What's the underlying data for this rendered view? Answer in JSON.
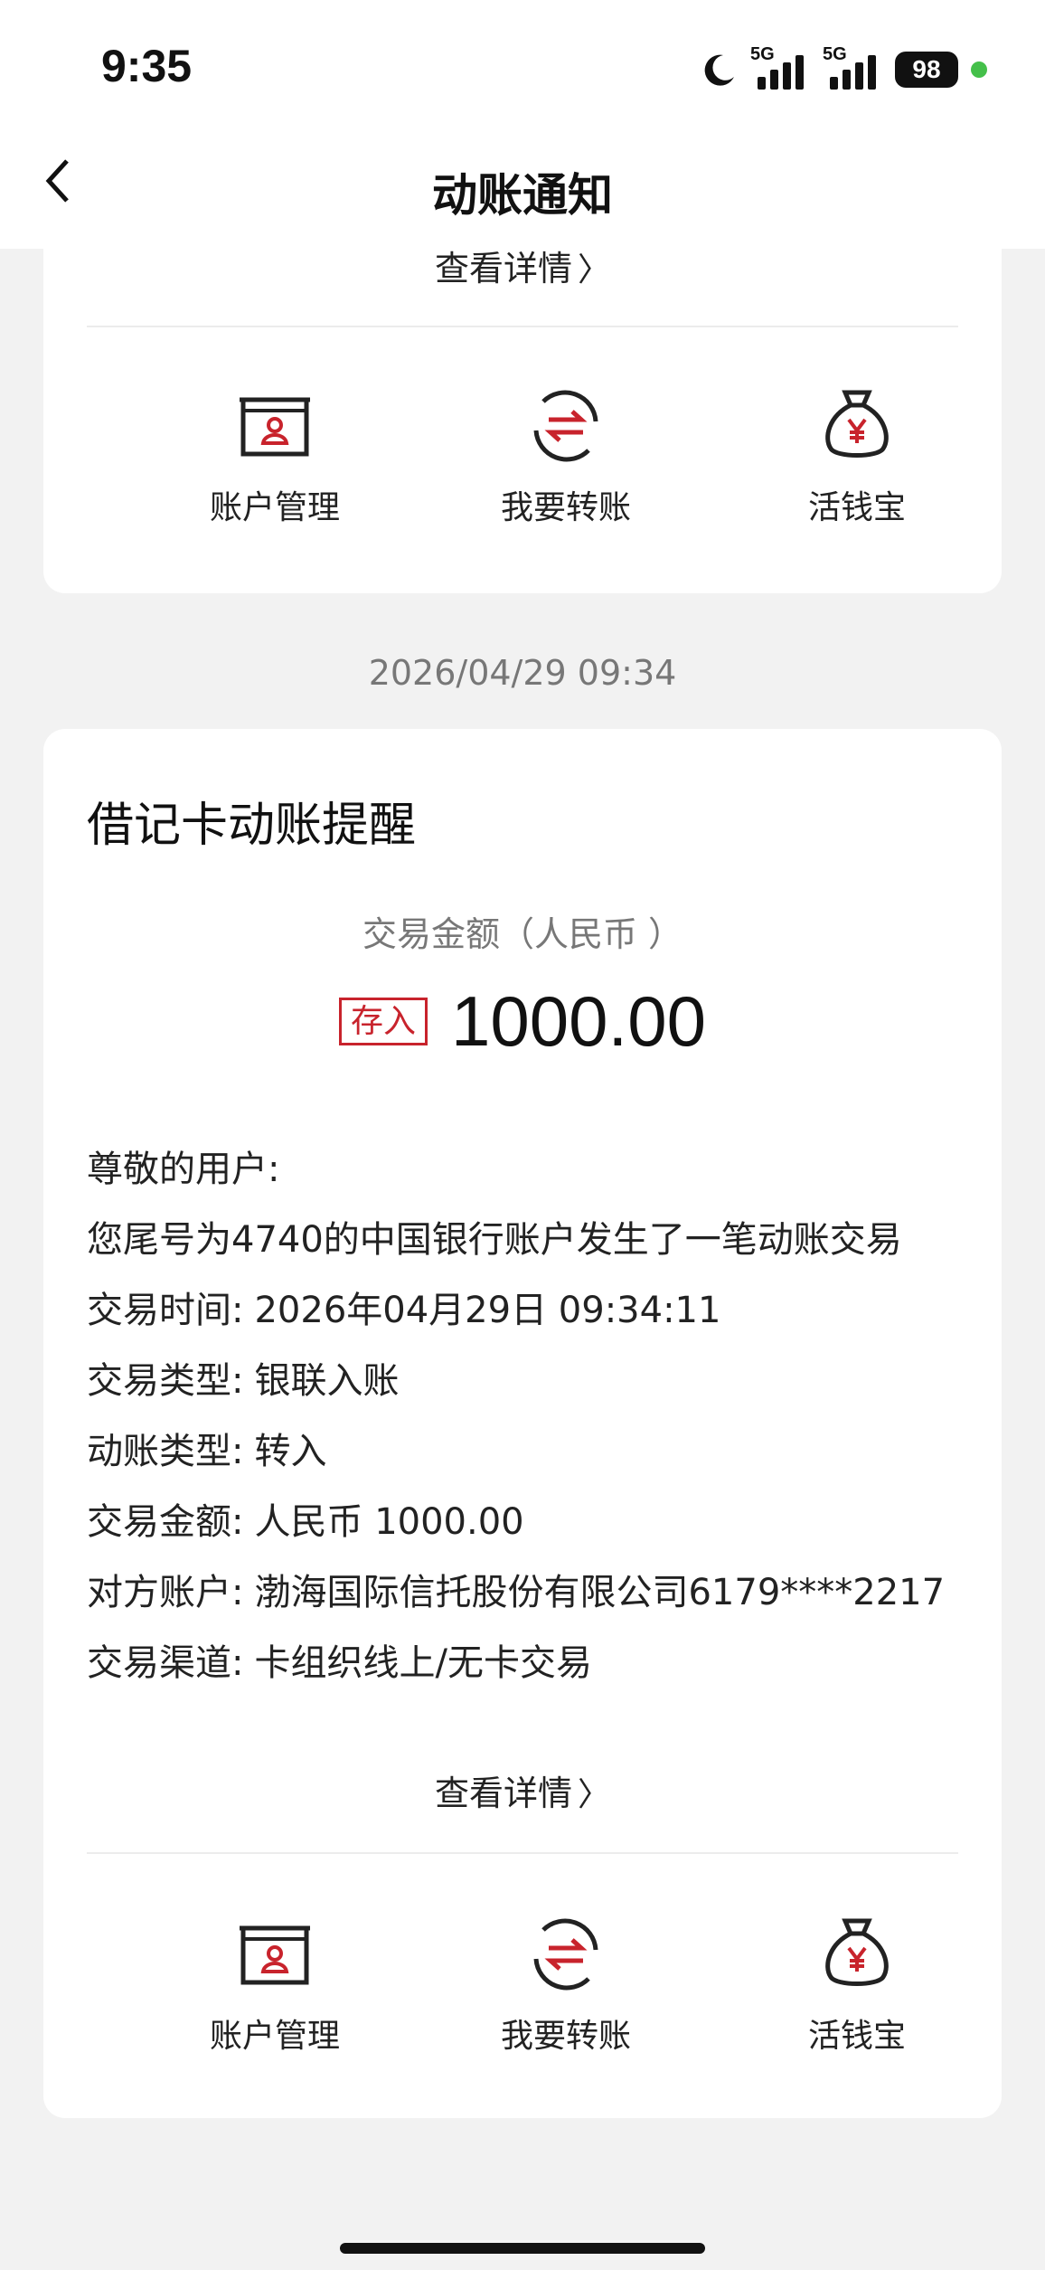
{
  "status_bar": {
    "time": "9:35",
    "network_1": "5G",
    "network_2": "5G",
    "battery": "98"
  },
  "nav": {
    "title": "动账通知"
  },
  "colors": {
    "accent": "#c8232c",
    "background": "#f2f2f2",
    "card": "#ffffff"
  },
  "top_card": {
    "detail_label": "查看详情",
    "shortcuts": [
      {
        "label": "账户管理",
        "icon": "account-card-icon"
      },
      {
        "label": "我要转账",
        "icon": "transfer-icon"
      },
      {
        "label": "活钱宝",
        "icon": "money-bag-icon"
      }
    ]
  },
  "message_time": "2026/04/29 09:34",
  "main_card": {
    "title": "借记卡动账提醒",
    "amount_caption": "交易金额（人民币 ）",
    "badge": "存入",
    "amount": "1000.00",
    "lines": [
      {
        "text": "尊敬的用户:"
      },
      {
        "text": "您尾号为4740的中国银行账户发生了一笔动账交易"
      },
      {
        "key": "交易时间:",
        "value": "2026年04月29日 09:34:11"
      },
      {
        "key": "交易类型:",
        "value": "银联入账"
      },
      {
        "key": "动账类型:",
        "value": "转入"
      },
      {
        "key": "交易金额:",
        "value": "人民币 1000.00"
      },
      {
        "key": "对方账户:",
        "value": "渤海国际信托股份有限公司6179****2217"
      },
      {
        "key": "交易渠道:",
        "value": "卡组织线上/无卡交易"
      }
    ],
    "detail_label": "查看详情",
    "shortcuts": [
      {
        "label": "账户管理",
        "icon": "account-card-icon"
      },
      {
        "label": "我要转账",
        "icon": "transfer-icon"
      },
      {
        "label": "活钱宝",
        "icon": "money-bag-icon"
      }
    ]
  }
}
